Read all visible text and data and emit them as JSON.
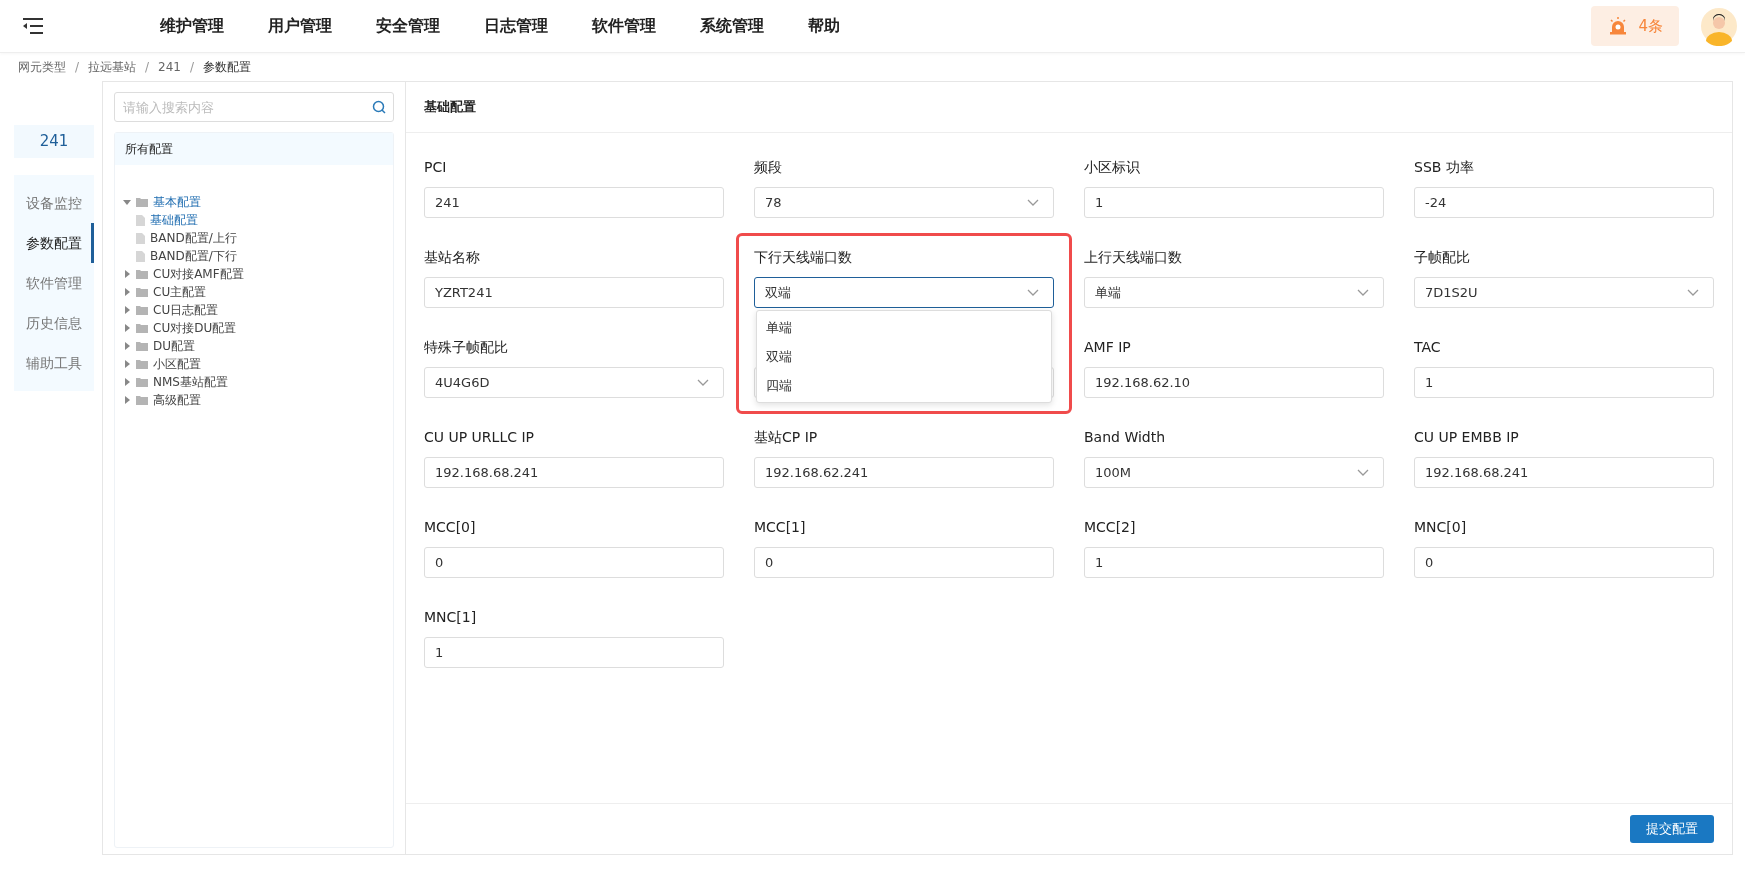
{
  "top_menu": [
    "维护管理",
    "用户管理",
    "安全管理",
    "日志管理",
    "软件管理",
    "系统管理",
    "帮助"
  ],
  "alarm": {
    "count": "4条"
  },
  "breadcrumb": [
    "网元类型",
    "拉远基站",
    "241",
    "参数配置"
  ],
  "breadcrumb_separator": "/",
  "device": {
    "name": "241"
  },
  "side_nav": [
    {
      "label": "设备监控",
      "selected": false
    },
    {
      "label": "参数配置",
      "selected": true
    },
    {
      "label": "软件管理",
      "selected": false
    },
    {
      "label": "历史信息",
      "selected": false
    },
    {
      "label": "辅助工具",
      "selected": false
    }
  ],
  "search": {
    "placeholder": "请输入搜索内容"
  },
  "tree": {
    "title": "所有配置",
    "items": [
      {
        "label": "基本配置",
        "expanded": true,
        "children": [
          {
            "label": "基础配置",
            "selected": true
          },
          {
            "label": "BAND配置/上行",
            "selected": false
          },
          {
            "label": "BAND配置/下行",
            "selected": false
          }
        ]
      },
      {
        "label": "CU对接AMF配置",
        "expanded": false
      },
      {
        "label": "CU主配置",
        "expanded": false
      },
      {
        "label": "CU日志配置",
        "expanded": false
      },
      {
        "label": "CU对接DU配置",
        "expanded": false
      },
      {
        "label": "DU配置",
        "expanded": false
      },
      {
        "label": "小区配置",
        "expanded": false
      },
      {
        "label": "NMS基站配置",
        "expanded": false
      },
      {
        "label": "高级配置",
        "expanded": false
      }
    ]
  },
  "form": {
    "title": "基础配置",
    "fields": [
      {
        "kind": "input",
        "label": "PCI",
        "value": "241"
      },
      {
        "kind": "select",
        "label": "频段",
        "value": "78"
      },
      {
        "kind": "input",
        "label": "小区标识",
        "value": "1"
      },
      {
        "kind": "input",
        "label": "SSB 功率",
        "value": "-24"
      },
      {
        "kind": "input",
        "label": "基站名称",
        "value": "YZRT241"
      },
      {
        "kind": "select",
        "label": "下行天线端口数",
        "value": "双端",
        "focused": true,
        "highlighted": true,
        "options": [
          "单端",
          "双端",
          "四端"
        ]
      },
      {
        "kind": "select",
        "label": "上行天线端口数",
        "value": "单端"
      },
      {
        "kind": "select",
        "label": "子帧配比",
        "value": "7D1S2U"
      },
      {
        "kind": "select",
        "label": "特殊子帧配比",
        "value": "4U4G6D"
      },
      {
        "kind": "hidden"
      },
      {
        "kind": "input",
        "label": "AMF IP",
        "value": "192.168.62.10"
      },
      {
        "kind": "input",
        "label": "TAC",
        "value": "1"
      },
      {
        "kind": "input",
        "label": "CU UP URLLC IP",
        "value": "192.168.68.241"
      },
      {
        "kind": "input",
        "label": "基站CP IP",
        "value": "192.168.62.241"
      },
      {
        "kind": "select",
        "label": "Band Width",
        "value": "100M"
      },
      {
        "kind": "input",
        "label": "CU UP EMBB IP",
        "value": "192.168.68.241"
      },
      {
        "kind": "input",
        "label": "MCC[0]",
        "value": "0"
      },
      {
        "kind": "input",
        "label": "MCC[1]",
        "value": "0"
      },
      {
        "kind": "input",
        "label": "MCC[2]",
        "value": "1"
      },
      {
        "kind": "input",
        "label": "MNC[0]",
        "value": "0"
      },
      {
        "kind": "input",
        "label": "MNC[1]",
        "value": "1"
      }
    ]
  },
  "submit_button": "提交配置"
}
